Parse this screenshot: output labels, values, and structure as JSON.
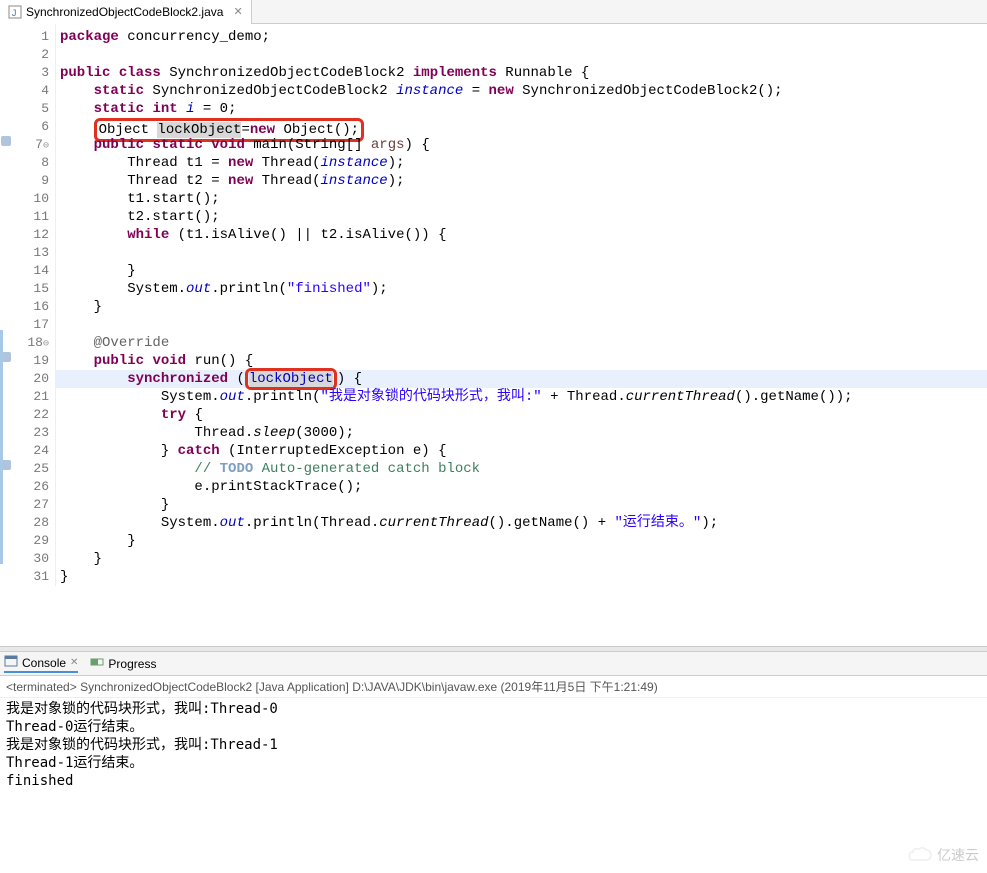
{
  "tab": {
    "filename": "SynchronizedObjectCodeBlock2.java",
    "close": "✕"
  },
  "lines": {
    "ln": [
      "1",
      "2",
      "3",
      "4",
      "5",
      "6",
      "7",
      "8",
      "9",
      "10",
      "11",
      "12",
      "13",
      "14",
      "15",
      "16",
      "17",
      "18",
      "19",
      "20",
      "21",
      "22",
      "23",
      "24",
      "25",
      "26",
      "27",
      "28",
      "29",
      "30",
      "31"
    ]
  },
  "code": {
    "l1": {
      "kw1": "package",
      "t1": " concurrency_demo;"
    },
    "l3": {
      "kw1": "public",
      "kw2": "class",
      "t1": " SynchronizedObjectCodeBlock2 ",
      "kw3": "implements",
      "t2": " Runnable {"
    },
    "l4": {
      "kw1": "static",
      "t1": " SynchronizedObjectCodeBlock2 ",
      "fi": "instance",
      "t2": " = ",
      "kw2": "new",
      "t3": " SynchronizedObjectCodeBlock2();"
    },
    "l5": {
      "kw1": "static",
      "kw2": "int",
      "fi": "i",
      "t1": " = 0;"
    },
    "l6": {
      "t0": "Object ",
      "hl": "lockObject",
      "t1": "=",
      "kw1": "new",
      "t2": " Object();"
    },
    "l7": {
      "kw1": "public",
      "kw2": "static",
      "kw3": "void",
      "t1": " main(String[] ",
      "p": "args",
      "t2": ") {"
    },
    "l8": {
      "t0": "Thread t1 = ",
      "kw1": "new",
      "t1": " Thread(",
      "fi": "instance",
      "t2": ");"
    },
    "l9": {
      "t0": "Thread t2 = ",
      "kw1": "new",
      "t1": " Thread(",
      "fi": "instance",
      "t2": ");"
    },
    "l10": {
      "t": "t1.start();"
    },
    "l11": {
      "t": "t2.start();"
    },
    "l12": {
      "kw1": "while",
      "t": " (t1.isAlive() || t2.isAlive()) {"
    },
    "l14": {
      "t": "}"
    },
    "l15": {
      "t0": "System.",
      "fi": "out",
      "t1": ".println(",
      "s": "\"finished\"",
      "t2": ");"
    },
    "l16": {
      "t": "}"
    },
    "l18": {
      "ann": "@Override"
    },
    "l19": {
      "kw1": "public",
      "kw2": "void",
      "t": " run() {"
    },
    "l20": {
      "kw1": "synchronized",
      "t0": " (",
      "hl": "lockObject",
      "t1": ") {"
    },
    "l21": {
      "t0": "System.",
      "fi": "out",
      "t1": ".println(",
      "s": "\"我是对象锁的代码块形式，我叫:\"",
      "t2": " + Thread.",
      "m": "currentThread",
      "t3": "().getName());"
    },
    "l22": {
      "kw1": "try",
      "t": " {"
    },
    "l23": {
      "t0": "Thread.",
      "m": "sleep",
      "t1": "(3000);"
    },
    "l24": {
      "t0": "} ",
      "kw1": "catch",
      "t1": " (InterruptedException e) {"
    },
    "l25": {
      "c0": "// ",
      "todo": "TODO",
      "c1": " Auto-generated catch block"
    },
    "l26": {
      "t": "e.printStackTrace();"
    },
    "l27": {
      "t": "}"
    },
    "l28": {
      "t0": "System.",
      "fi": "out",
      "t1": ".println(Thread.",
      "m": "currentThread",
      "t2": "().getName() + ",
      "s": "\"运行结束。\"",
      "t3": ");"
    },
    "l29": {
      "t": "}"
    },
    "l30": {
      "t": "}"
    },
    "l31": {
      "t": "}"
    }
  },
  "console": {
    "tab1": "Console",
    "tab2": "Progress",
    "header_prefix": "<terminated>",
    "header": "SynchronizedObjectCodeBlock2 [Java Application] D:\\JAVA\\JDK\\bin\\javaw.exe (2019年11月5日 下午1:21:49)",
    "out1": "我是对象锁的代码块形式，我叫:Thread-0",
    "out2": "Thread-0运行结束。",
    "out3": "我是对象锁的代码块形式，我叫:Thread-1",
    "out4": "Thread-1运行结束。",
    "out5": "finished"
  },
  "watermark": "亿速云"
}
